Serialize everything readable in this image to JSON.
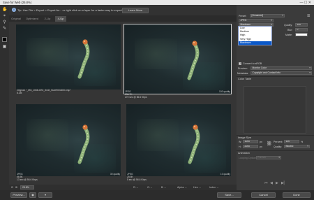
{
  "window": {
    "title": "Save for Web (25.8%)",
    "controls": "—  ☐  ✕"
  },
  "hint": {
    "icon": "info-icon",
    "text": "Tip: Use File > Export > Export As... or right click on a layer for a faster way to export assets.",
    "learn_more": "Learn More"
  },
  "tabs": [
    {
      "label": "Original",
      "active": false
    },
    {
      "label": "Optimized",
      "active": false
    },
    {
      "label": "2-Up",
      "active": false
    },
    {
      "label": "4-Up",
      "active": true
    }
  ],
  "previews": [
    {
      "left": "Original: \"_MG_1068-CR2_5ml2_Siwe900x600.bmp\"",
      "left2": "8.2M",
      "right": ""
    },
    {
      "left": "JPEG",
      "left2": "236.7K",
      "left3": "272 sec @ 56.6 Kbps",
      "right": "100 quality"
    },
    {
      "left": "JPEG",
      "left2": "56.5K",
      "left3": "13 sec @ 56.6 Kbps",
      "right": "30 quality"
    },
    {
      "left": "JPEG",
      "left2": "25.5K",
      "left3": "5 sec @ 56.6 Kbps",
      "right": "10 quality"
    }
  ],
  "zoombar": {
    "zoom": "25.8%",
    "r": "R: --",
    "g": "G: --",
    "b": "B: --",
    "alpha": "Alpha: --",
    "hex": "Hex: --",
    "index": "Index: --"
  },
  "footer": {
    "preview": "Preview...",
    "save": "Save...",
    "cancel": "Cancel",
    "done": "Done"
  },
  "panel": {
    "preset_label": "Preset:",
    "preset_value": "[Unnamed]",
    "format_value": "JPEG",
    "quality_dd": "Maximum",
    "quality_label": "Quality:",
    "quality_value": "100",
    "blur_label": "Blur:",
    "blur_value": "0",
    "matte_label": "Matte:",
    "quality_menu": [
      "Low",
      "Medium",
      "High",
      "Very High",
      "Maximum"
    ],
    "quality_menu_selected": 4,
    "convert_srgb": "Convert to sRGB",
    "preview_label": "Preview:",
    "preview_value": "Monitor Color",
    "metadata_label": "Metadata:",
    "metadata_value": "Copyright and Contact Info",
    "color_table": "Color Table",
    "image_size": "Image Size",
    "w_label": "W:",
    "w_value": "1000",
    "h_label": "H:",
    "h_value": "2000",
    "px": "px",
    "percent_label": "Percent:",
    "percent_value": "100",
    "pct": "%",
    "quality2_label": "Quality:",
    "quality2_value": "Bicubic",
    "animation": "Animation",
    "looping_label": "Looping Options:",
    "looping_value": "Forever"
  },
  "colors": {
    "accent": "#0a58c8",
    "caterpillar": "#8fb27a",
    "head": "#d8763a"
  }
}
